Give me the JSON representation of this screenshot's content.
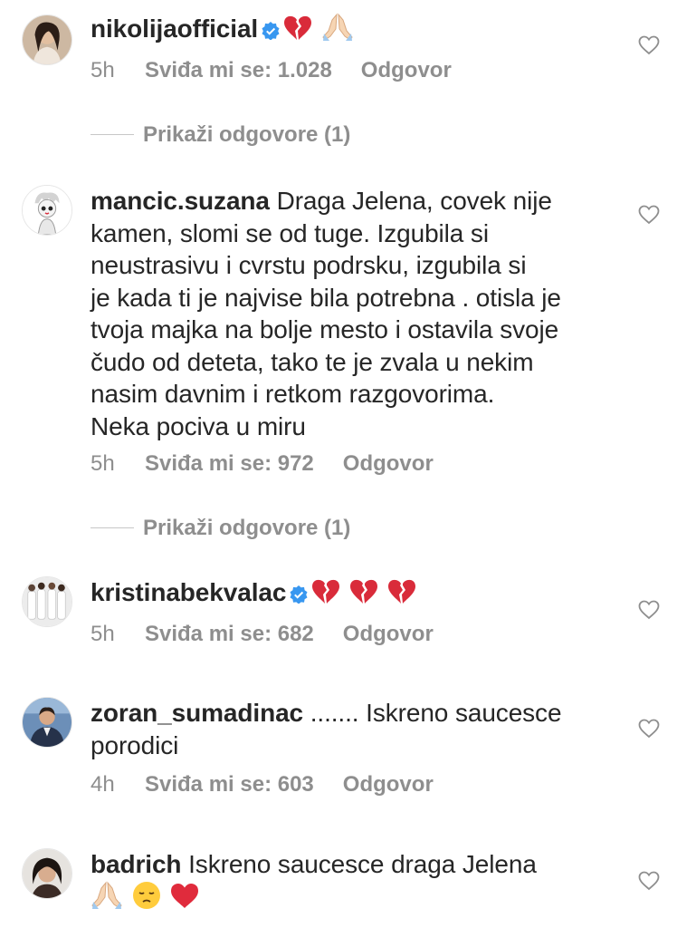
{
  "comments": [
    {
      "username": "nikolijaofficial",
      "verified": true,
      "text": "",
      "emojis": [
        "broken-heart-emoji",
        "folded-hands-emoji"
      ],
      "time": "5h",
      "likes": "Sviđa mi se: 1.028",
      "reply": "Odgovor",
      "show_replies": "Prikaži odgovore (1)"
    },
    {
      "username": "mancic.suzana",
      "verified": false,
      "lines": [
        " Draga Jelena, covek nije",
        "kamen, slomi se od tuge. Izgubila si",
        "neustrasivu i cvrstu podrsku,  izgubila si",
        "je kada ti je najvise bila potrebna . otisla je",
        "tvoja majka na bolje mesto i ostavila svoje",
        "čudo od deteta, tako te je zvala u nekim",
        "nasim davnim i retkom razgovorima.",
        "Neka pociva u miru"
      ],
      "time": "5h",
      "likes": "Sviđa mi se: 972",
      "reply": "Odgovor",
      "show_replies": "Prikaži odgovore (1)"
    },
    {
      "username": "kristinabekvalac",
      "verified": true,
      "emojis": [
        "broken-heart-emoji",
        "broken-heart-emoji",
        "broken-heart-emoji"
      ],
      "time": "5h",
      "likes": "Sviđa mi se: 682",
      "reply": "Odgovor"
    },
    {
      "username": "zoran_sumadinac",
      "verified": false,
      "lines": [
        " ....... Iskreno saucesce",
        "porodici"
      ],
      "time": "4h",
      "likes": "Sviđa mi se: 603",
      "reply": "Odgovor"
    },
    {
      "username": "badrich",
      "verified": false,
      "lines": [
        " Iskreno saucesce draga Jelena"
      ],
      "emojis": [
        "folded-hands-emoji",
        "pensive-face-emoji",
        "red-heart-emoji"
      ]
    }
  ],
  "colors": {
    "text": "#262626",
    "secondary": "#8e8e8e",
    "verified": "#3897f0",
    "heart_emoji": "#d92b3a"
  }
}
